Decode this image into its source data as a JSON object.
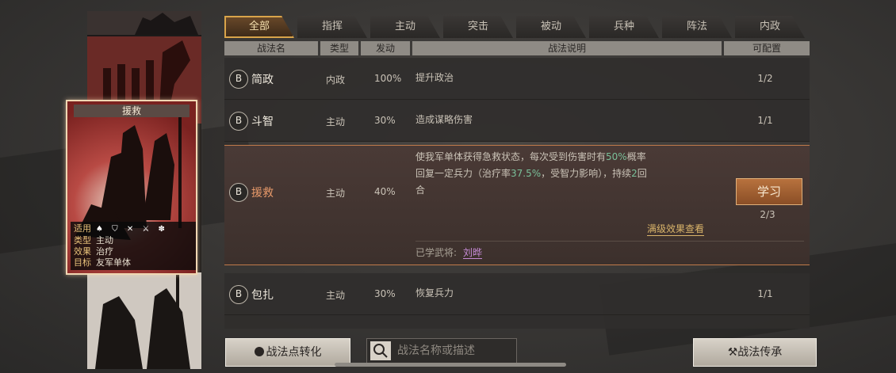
{
  "tabs": [
    "全部",
    "指挥",
    "主动",
    "突击",
    "被动",
    "兵种",
    "阵法",
    "内政"
  ],
  "headers": {
    "name": "战法名",
    "type": "类型",
    "rate": "发动",
    "desc": "战法说明",
    "count": "可配置"
  },
  "card": {
    "title": "援救",
    "info": [
      {
        "k": "适用",
        "v": ""
      },
      {
        "k": "类型",
        "v": "主动"
      },
      {
        "k": "效果",
        "v": "治疗"
      },
      {
        "k": "目标",
        "v": "友军单体"
      }
    ],
    "icons": "♠ ⛉ ✕ ⚔ ✽"
  },
  "rows": [
    {
      "grade": "B",
      "name": "简政",
      "type": "内政",
      "rate": "100%",
      "desc": "提升政治",
      "count": "1/2"
    },
    {
      "grade": "B",
      "name": "斗智",
      "type": "主动",
      "rate": "30%",
      "desc": "造成谋略伤害",
      "count": "1/1"
    },
    {
      "grade": "B",
      "name": "援救",
      "type": "主动",
      "rate": "40%",
      "desc_line1a": "使我军单体获得急救状态，每次受到伤害时有",
      "desc_line1b": "50%",
      "desc_line1c": "概率",
      "desc_line2a": "回复一定兵力（治疗率",
      "desc_line2b": "37.5%",
      "desc_line2c": "，受智力影响），持续",
      "desc_line2d": "2",
      "desc_line2e": "回",
      "desc_line3": "合",
      "count": "2/3",
      "learn": "学习",
      "view": "满级效果查看",
      "learned_label": "已学武将:",
      "learned_name": "刘晔"
    },
    {
      "grade": "B",
      "name": "包扎",
      "type": "主动",
      "rate": "30%",
      "desc": "恢复兵力",
      "count": "1/1"
    }
  ],
  "bottom": {
    "convert": "战法点转化",
    "search_placeholder": "战法名称或描述",
    "inherit": "战法传承"
  },
  "colors": {
    "accent": "#d9a44a",
    "highlight": "#7ac09a",
    "name_link": "#c68ad6"
  }
}
